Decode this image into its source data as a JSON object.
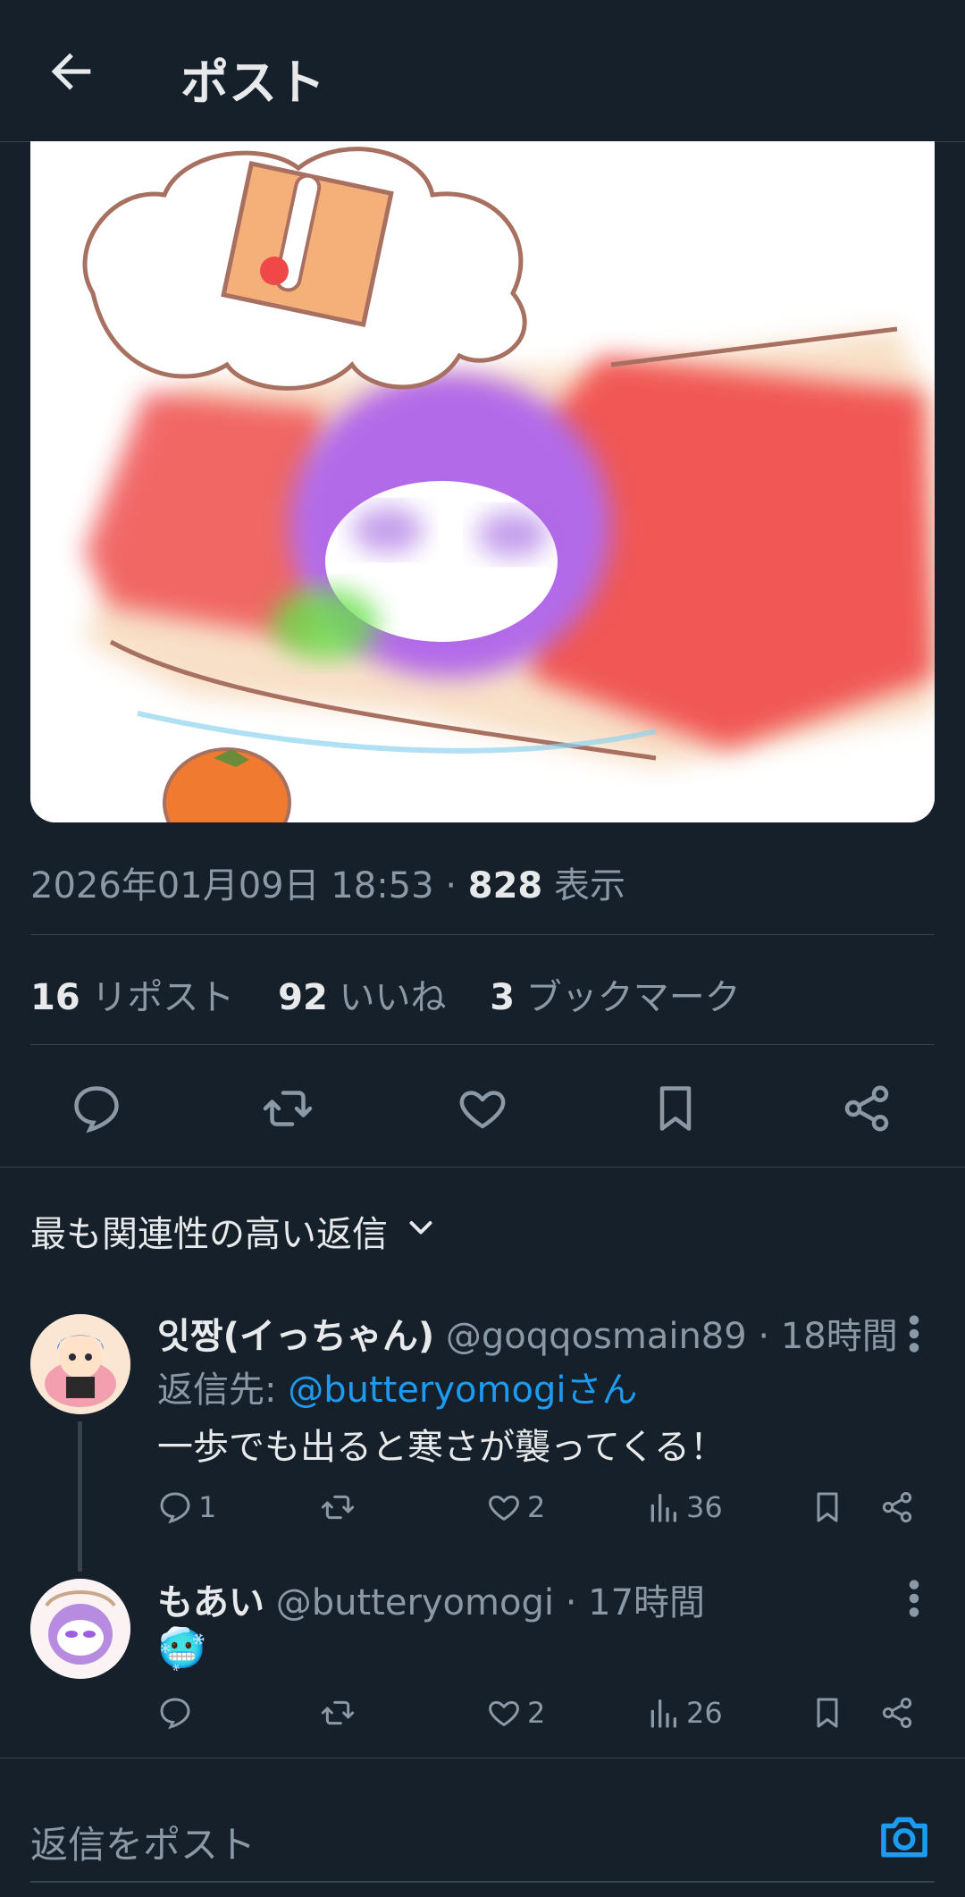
{
  "header": {
    "title": "ポスト"
  },
  "post": {
    "timestamp": "2026年01月09日 18:53",
    "separator": "·",
    "views": "828",
    "views_label": "表示",
    "reposts": "16",
    "reposts_label": "リポスト",
    "likes": "92",
    "likes_label": "いいね",
    "bookmarks": "3",
    "bookmarks_label": "ブックマーク"
  },
  "replies_header": {
    "label": "最も関連性の高い返信"
  },
  "replies": [
    {
      "name": "잇짱(イっちゃん)",
      "handle": "@goqqosmain89",
      "sep": "·",
      "time": "18時間",
      "reply_to_prefix": "返信先:",
      "reply_to_handle": "@butteryomogiさん",
      "text": "一歩でも出ると寒さが襲ってくる！",
      "comments": "1",
      "likes": "2",
      "views": "36"
    },
    {
      "name": "もあい",
      "handle": "@butteryomogi",
      "sep": "·",
      "time": "17時間",
      "text": "🥶",
      "likes": "2",
      "views": "26"
    }
  ],
  "composer": {
    "placeholder": "返信をポスト"
  },
  "colors": {
    "bg": "#15202b",
    "accent": "#1d9bf0",
    "muted": "#8b98a5",
    "border": "#38444d"
  }
}
